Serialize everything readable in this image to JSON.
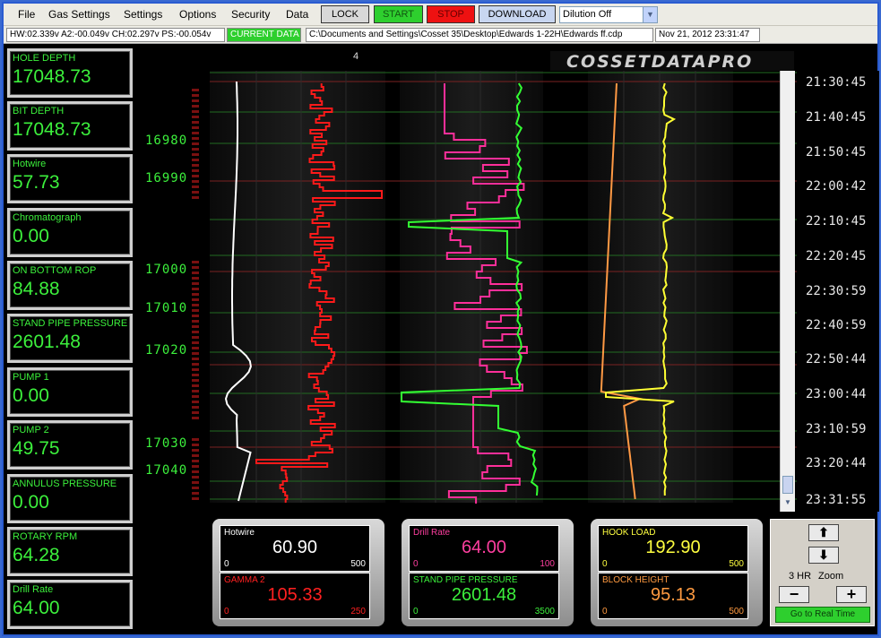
{
  "menu": [
    "File",
    "Gas Settings",
    "Settings",
    "Options",
    "Security",
    "Data"
  ],
  "toolbar": {
    "lock_label": "LOCK",
    "start_label": "START",
    "stop_label": "STOP",
    "download_label": "DOWNLOAD",
    "dilution_value": "Dilution Off"
  },
  "status": {
    "voltages": "HW:02.339v A2:-00.049v CH:02.297v PS:-00.054v",
    "current_data": "CURRENT DATA",
    "file_path": "C:\\Documents and Settings\\Cosset 35\\Desktop\\Edwards 1-22H\\Edwards ff.cdp",
    "datetime": "Nov 21, 2012  23:31:47"
  },
  "gauges": [
    {
      "label": "HOLE DEPTH",
      "value": "17048.73"
    },
    {
      "label": "BIT DEPTH",
      "value": "17048.73"
    },
    {
      "label": "Hotwire",
      "value": "57.73"
    },
    {
      "label": "Chromatograph",
      "value": "0.00"
    },
    {
      "label": "ON BOTTOM ROP",
      "value": "84.88"
    },
    {
      "label": "STAND PIPE PRESSURE",
      "value": "2601.48"
    },
    {
      "label": "PUMP 1",
      "value": "0.00"
    },
    {
      "label": "PUMP 2",
      "value": "49.75"
    },
    {
      "label": "ANNULUS PRESSURE",
      "value": "0.00"
    },
    {
      "label": "ROTARY RPM",
      "value": "64.28"
    },
    {
      "label": "Drill Rate",
      "value": "64.00"
    }
  ],
  "chart": {
    "brand": "COSSETDATAPRO",
    "top_number": "4",
    "depth_labels": [
      "16980",
      "16990",
      "17000",
      "17010",
      "17020",
      "17030",
      "17040"
    ],
    "time_labels": [
      "21:30:45",
      "21:40:45",
      "21:50:45",
      "22:00:42",
      "22:10:45",
      "22:20:45",
      "22:30:59",
      "22:40:59",
      "22:50:44",
      "23:00:44",
      "23:10:59",
      "23:20:44",
      "23:31:55"
    ],
    "colors": {
      "hotwire": "#ffffff",
      "gamma": "#ff1a1a",
      "drill_rate": "#ff2f9a",
      "spp": "#33ff33",
      "hook_load": "#ffff33",
      "block_height": "#ff9944"
    }
  },
  "readouts": {
    "hotwire": {
      "label": "Hotwire",
      "value": "60.90",
      "min": "0",
      "max": "500",
      "color": "#ffffff"
    },
    "gamma": {
      "label": "GAMMA 2",
      "value": "105.33",
      "min": "0",
      "max": "250",
      "color": "#ff2020"
    },
    "drill_rate": {
      "label": "Drill Rate",
      "value": "64.00",
      "min": "0",
      "max": "100",
      "color": "#ff3fa0"
    },
    "spp": {
      "label": "STAND PIPE PRESSURE",
      "value": "2601.48",
      "min": "0",
      "max": "3500",
      "color": "#3cf03c"
    },
    "hook_load": {
      "label": "HOOK LOAD",
      "value": "192.90",
      "min": "0",
      "max": "500",
      "color": "#ffff40"
    },
    "block_height": {
      "label": "BLOCK HEIGHT",
      "value": "95.13",
      "min": "0",
      "max": "500",
      "color": "#ff9a40"
    }
  },
  "zoom": {
    "range_label": "3 HR",
    "zoom_label": "Zoom",
    "realtime_label": "Go to Real Time"
  }
}
